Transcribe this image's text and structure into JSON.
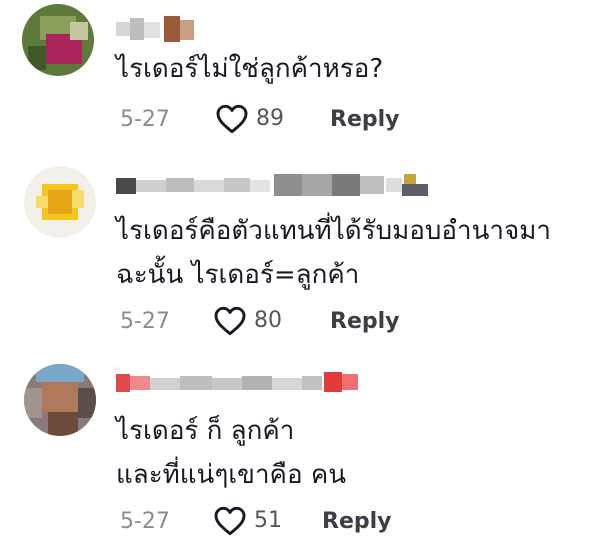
{
  "comments": [
    {
      "lines": [
        "ไรเดอร์ไม่ใช่ลูกค้าหรอ?"
      ],
      "date": "5-27",
      "likes": "89",
      "reply_label": "Reply"
    },
    {
      "lines": [
        "ไรเดอร์คือตัวแทนที่ได้รับมอบอำนาจมา",
        "ฉะนั้น ไรเดอร์=ลูกค้า"
      ],
      "date": "5-27",
      "likes": "80",
      "reply_label": "Reply"
    },
    {
      "lines": [
        "ไรเดอร์ ก็ ลูกค้า",
        "และที่แน่ๆเขาคือ คน"
      ],
      "date": "5-27",
      "likes": "51",
      "reply_label": "Reply"
    }
  ],
  "icons": {
    "like": "heart-outline-icon"
  },
  "colors": {
    "text": "#161823",
    "meta": "#8a8b91",
    "reply": "#3d3e44"
  }
}
